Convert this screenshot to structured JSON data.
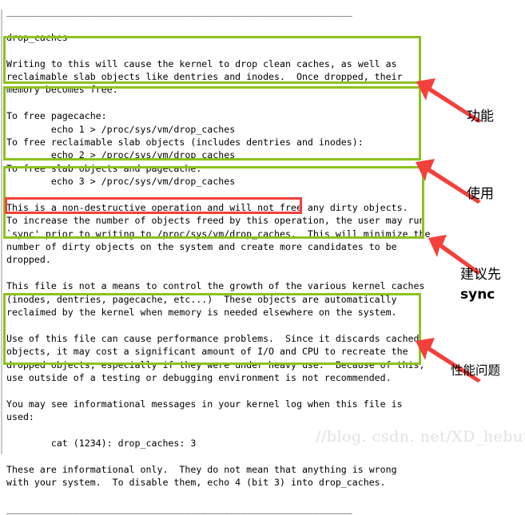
{
  "colors": {
    "green_highlight": "#8DC21F",
    "red_highlight": "#F4403A",
    "arrow_red": "#F4403A",
    "text": "#000000",
    "watermark": "#e2e2e2",
    "left_rule": "#c9c9c9"
  },
  "document": {
    "lines": [
      "______________________________________________________________",
      "",
      "drop_caches",
      "",
      "Writing to this will cause the kernel to drop clean caches, as well as",
      "reclaimable slab objects like dentries and inodes.  Once dropped, their",
      "memory becomes free.",
      "",
      "To free pagecache:",
      "        echo 1 > /proc/sys/vm/drop_caches",
      "To free reclaimable slab objects (includes dentries and inodes):",
      "        echo 2 > /proc/sys/vm/drop_caches",
      "To free slab objects and pagecache:",
      "        echo 3 > /proc/sys/vm/drop_caches",
      "",
      "This is a non-destructive operation and will not free any dirty objects.",
      "To increase the number of objects freed by this operation, the user may run",
      "`sync' prior to writing to /proc/sys/vm/drop_caches.  This will minimize the",
      "number of dirty objects on the system and create more candidates to be",
      "dropped.",
      "",
      "This file is not a means to control the growth of the various kernel caches",
      "(inodes, dentries, pagecache, etc...)  These objects are automatically",
      "reclaimed by the kernel when memory is needed elsewhere on the system.",
      "",
      "Use of this file can cause performance problems.  Since it discards cached",
      "objects, it may cost a significant amount of I/O and CPU to recreate the",
      "dropped objects, especially if they were under heavy use.  Because of this,",
      "use outside of a testing or debugging environment is not recommended.",
      "",
      "You may see informational messages in your kernel log when this file is",
      "used:",
      "",
      "        cat (1234): drop_caches: 3",
      "",
      "These are informational only.  They do not mean that anything is wrong",
      "with your system.  To disable them, echo 4 (bit 3) into drop_caches.",
      "",
      "______________________________________________________________"
    ]
  },
  "highlights": {
    "green": [
      {
        "id": "green-box-function",
        "label": "function-description-highlight"
      },
      {
        "id": "green-box-usage",
        "label": "usage-commands-highlight"
      },
      {
        "id": "green-box-sync",
        "label": "sync-recommendation-highlight"
      },
      {
        "id": "green-box-performance",
        "label": "performance-warning-highlight"
      }
    ],
    "red": [
      {
        "id": "red-box-sync-phrase",
        "label": "sync-phrase-highlight"
      }
    ]
  },
  "annotations": [
    {
      "id": "anno-function",
      "text": "功能",
      "meaning": "function"
    },
    {
      "id": "anno-usage",
      "text": "使用",
      "meaning": "usage"
    },
    {
      "id": "anno-sync-line1",
      "text": "建议先",
      "meaning": "recommend first"
    },
    {
      "id": "anno-sync-line2",
      "text": "sync",
      "meaning": "sync command"
    },
    {
      "id": "anno-performance",
      "text": "性能问题",
      "meaning": "performance problem"
    }
  ],
  "watermark": {
    "text": "//blog. csdn. net/XD_hebuters"
  }
}
